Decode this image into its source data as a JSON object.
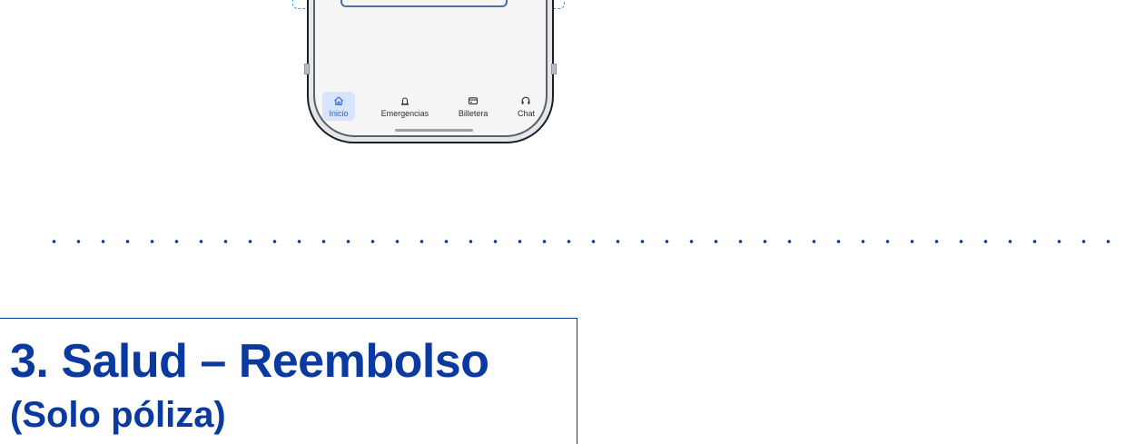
{
  "phone": {
    "bottom_nav": {
      "items": [
        {
          "label": "Inicio",
          "icon": "home-icon",
          "active": true
        },
        {
          "label": "Emergencias",
          "icon": "siren-icon",
          "active": false
        },
        {
          "label": "Billetera",
          "icon": "wallet-icon",
          "active": false
        },
        {
          "label": "Chat",
          "icon": "headset-icon",
          "active": false
        }
      ]
    }
  },
  "section": {
    "title": "3. Salud – Reembolso",
    "subtitle": "(Solo póliza)"
  },
  "colors": {
    "brand_blue": "#0a3aa0",
    "active_nav_bg": "#d6e4ff",
    "active_nav_text": "#2563c9",
    "highlight_dashed": "#2ea3c8"
  }
}
